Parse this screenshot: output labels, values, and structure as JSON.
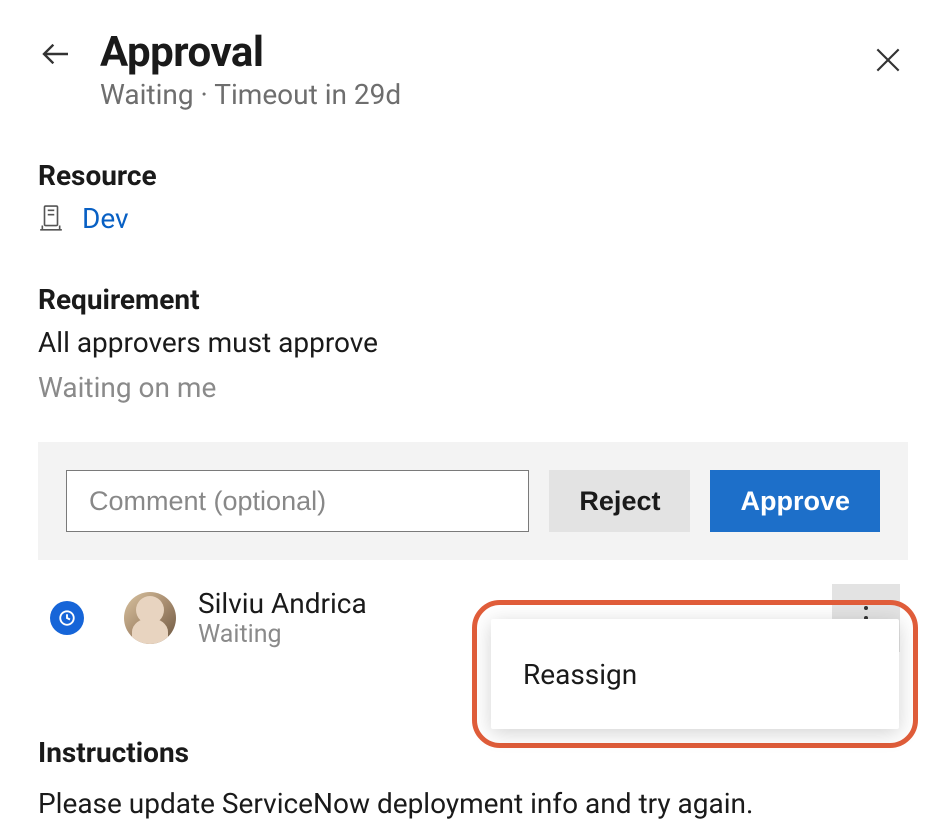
{
  "header": {
    "title": "Approval",
    "status": "Waiting",
    "separator": " · ",
    "timeout": "Timeout in 29d"
  },
  "resource": {
    "label": "Resource",
    "name": "Dev"
  },
  "requirement": {
    "label": "Requirement",
    "text": "All approvers must approve",
    "waiting": "Waiting on me"
  },
  "actions": {
    "comment_placeholder": "Comment (optional)",
    "reject": "Reject",
    "approve": "Approve"
  },
  "approver": {
    "name": "Silviu Andrica",
    "status": "Waiting"
  },
  "menu": {
    "reassign": "Reassign"
  },
  "instructions": {
    "label": "Instructions",
    "text": "Please update ServiceNow deployment info and try again."
  }
}
